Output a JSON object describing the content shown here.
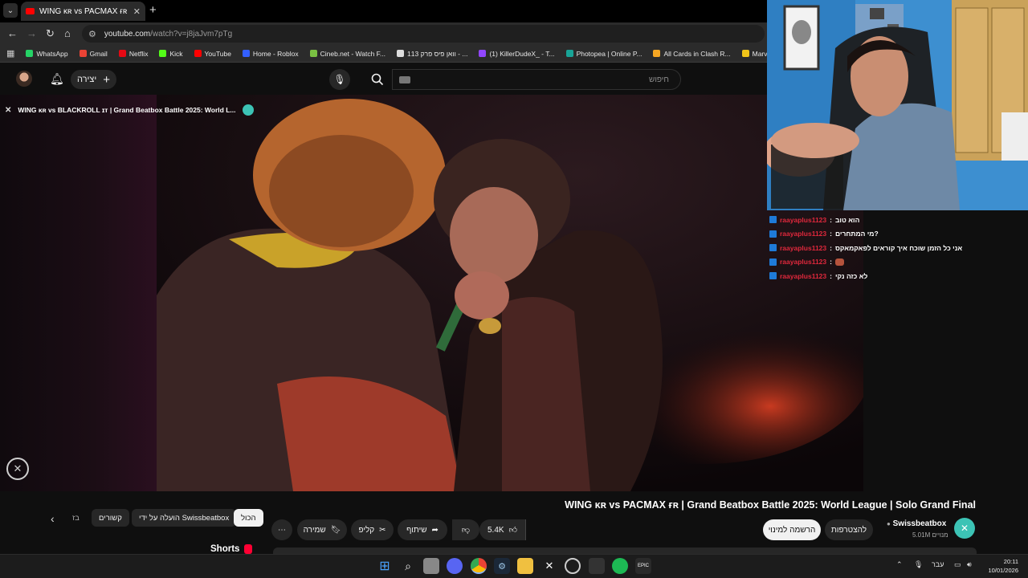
{
  "browser": {
    "tab_title": "WING ᴋʀ vs PACMAX ғʀ | Grand",
    "url_host": "youtube.com",
    "url_path": "/watch?v=j8jaJvm7pTg"
  },
  "bookmarks": [
    {
      "label": "WhatsApp",
      "color": "#25d366"
    },
    {
      "label": "Gmail",
      "color": "#ea4335"
    },
    {
      "label": "Netflix",
      "color": "#e50914"
    },
    {
      "label": "Kick",
      "color": "#53fc18"
    },
    {
      "label": "YouTube",
      "color": "#ff0000"
    },
    {
      "label": "Home - Roblox",
      "color": "#335fff"
    },
    {
      "label": "Cineb.net - Watch F...",
      "color": "#7ac142"
    },
    {
      "label": "וואן פיס פרק 113 - ...",
      "color": "#dddddd"
    },
    {
      "label": "(1) KillerDudeX_ - T...",
      "color": "#9146ff"
    },
    {
      "label": "Photopea | Online P...",
      "color": "#18a497"
    },
    {
      "label": "All Cards in Clash R...",
      "color": "#f5a623"
    },
    {
      "label": "Marvel Cinemat",
      "color": "#f0c419"
    }
  ],
  "youtube_header": {
    "create_label": "יצירה",
    "search_placeholder": "חיפוש"
  },
  "miniplayer": {
    "title": "WING ᴋʀ vs BLACKROLL ɪᴛ | Grand Beatbox Battle 2025: World L..."
  },
  "chat": [
    {
      "user": "raayaplus1123",
      "message": "הוא טוב"
    },
    {
      "user": "raayaplus1123",
      "message": "מי המתחרים?"
    },
    {
      "user": "raayaplus1123",
      "message": "אני כל הזמן שוכח איך קוראים לפאקמאקס"
    },
    {
      "user": "raayaplus1123",
      "message": "",
      "emoji": "face-emoji"
    },
    {
      "user": "raayaplus1123",
      "message": "לא כזה נקי"
    }
  ],
  "video": {
    "title": "WING ᴋʀ vs PACMAX ғʀ | Grand Beatbox Battle 2025: World League | Solo Grand Final",
    "channel_name": "Swissbeatbox",
    "subscribers": "5.01M מנויים",
    "subscribe_label": "הרשמה למינוי",
    "join_label": "להצטרפות",
    "like_count": "5.4K",
    "share_label": "שיתוף",
    "clip_label": "קליפ",
    "save_label": "שמירה"
  },
  "chips": {
    "all": "הכול",
    "channel": "הועלה על ידי Swissbeatbox",
    "related": "קשורים",
    "more": "בז"
  },
  "shorts_label": "Shorts",
  "taskbar": {
    "language": "עבר",
    "time": "20:11",
    "date": "10/01/2026"
  }
}
